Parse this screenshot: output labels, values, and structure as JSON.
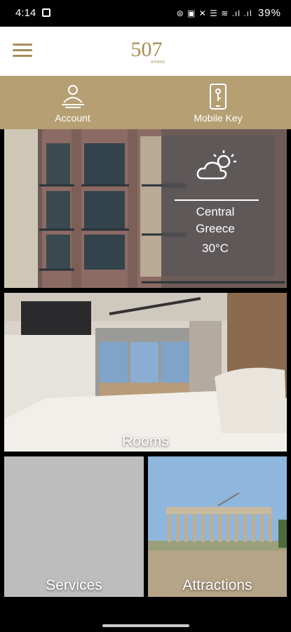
{
  "status": {
    "time": "4:14",
    "battery": "39%",
    "icons": "⊜ ▣ ✕ ☰ ≋ .ıl .ıl"
  },
  "appbar": {
    "logo_text": "507",
    "menu_icon": "hamburger-icon"
  },
  "nav": {
    "account_label": "Account",
    "mobilekey_label": "Mobile Key"
  },
  "weather": {
    "location_line1": "Central",
    "location_line2": "Greece",
    "temperature": "30°C"
  },
  "tiles": {
    "rooms": "Rooms",
    "services": "Services",
    "attractions": "Attractions"
  },
  "colors": {
    "accent": "#b59f73",
    "logo": "#a88c58"
  }
}
